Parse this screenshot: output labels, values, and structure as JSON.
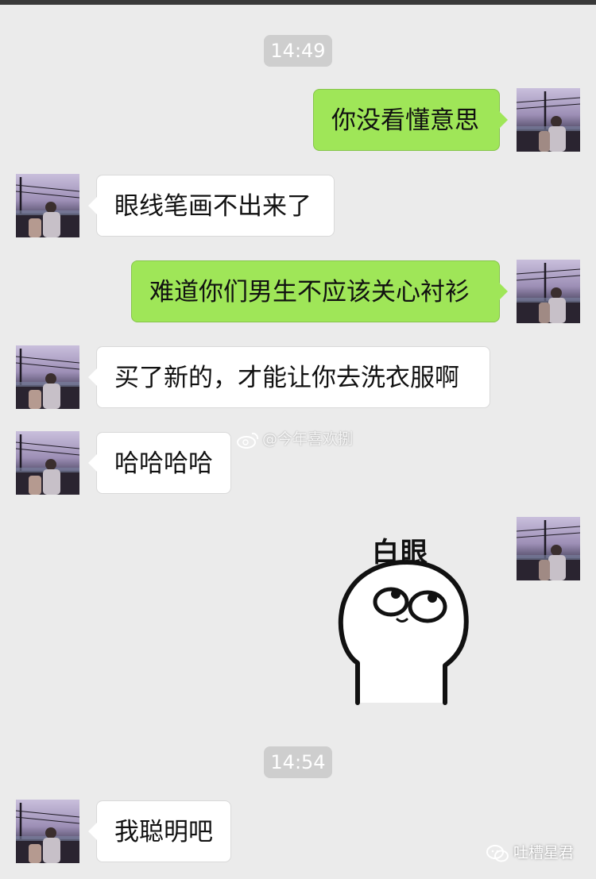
{
  "timestamps": [
    "14:49",
    "14:54"
  ],
  "messages": [
    {
      "side": "right",
      "text": "你没看懂意思"
    },
    {
      "side": "left",
      "text": "眼线笔画不出来了"
    },
    {
      "side": "right",
      "text": "难道你们男生不应该关心衬衫"
    },
    {
      "side": "left",
      "text": "买了新的，才能让你去洗衣服啊"
    },
    {
      "side": "left",
      "text": "哈哈哈哈"
    },
    {
      "side": "right",
      "sticker": true,
      "caption": "白眼"
    },
    {
      "side": "left",
      "text": "我聪明吧"
    }
  ],
  "watermark": {
    "text": "@今年喜欢捌",
    "icon": "weibo-icon"
  },
  "brand": {
    "text": "吐槽星君",
    "icon": "wechat-icon"
  },
  "colors": {
    "background": "#ebebeb",
    "sent_bubble": "#9fe658",
    "received_bubble": "#ffffff",
    "time_badge": "#cecece"
  }
}
